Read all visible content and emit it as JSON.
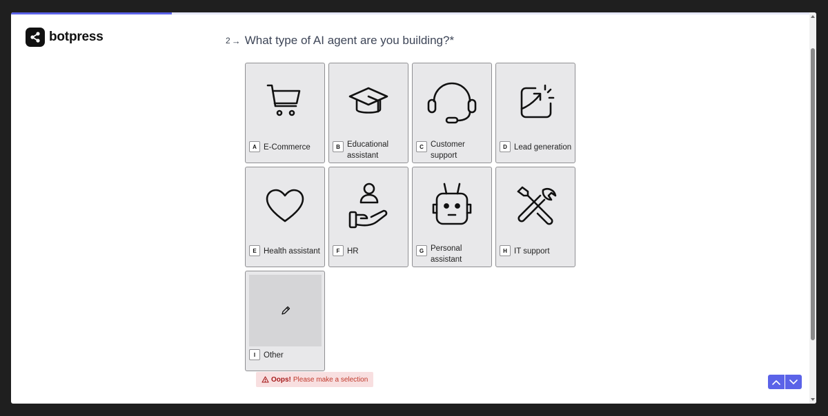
{
  "app": {
    "brand": "botpress"
  },
  "progress": {
    "fraction": 0.2
  },
  "question": {
    "number": "2",
    "arrow": "→",
    "text": "What type of AI agent are you building?*"
  },
  "options": [
    {
      "key": "A",
      "label": "E-Commerce",
      "icon": "shopping-cart-icon"
    },
    {
      "key": "B",
      "label": "Educational assistant",
      "icon": "graduation-cap-icon"
    },
    {
      "key": "C",
      "label": "Customer support",
      "icon": "headset-icon"
    },
    {
      "key": "D",
      "label": "Lead generation",
      "icon": "chart-growth-icon"
    },
    {
      "key": "E",
      "label": "Health assistant",
      "icon": "heart-icon"
    },
    {
      "key": "F",
      "label": "HR",
      "icon": "person-in-hand-icon"
    },
    {
      "key": "G",
      "label": "Personal assistant",
      "icon": "robot-icon"
    },
    {
      "key": "H",
      "label": "IT support",
      "icon": "tools-icon"
    },
    {
      "key": "I",
      "label": "Other",
      "icon": "pencil-icon"
    }
  ],
  "error": {
    "strong": "Oops!",
    "message": "Please make a selection",
    "icon": "warning-icon"
  },
  "nav": {
    "up_icon": "chevron-up-icon",
    "down_icon": "chevron-down-icon"
  },
  "colors": {
    "accent": "#5b63e8",
    "card_bg": "#e8e8ea",
    "error_bg": "#f8dfe0",
    "error_text": "#c0392b"
  }
}
